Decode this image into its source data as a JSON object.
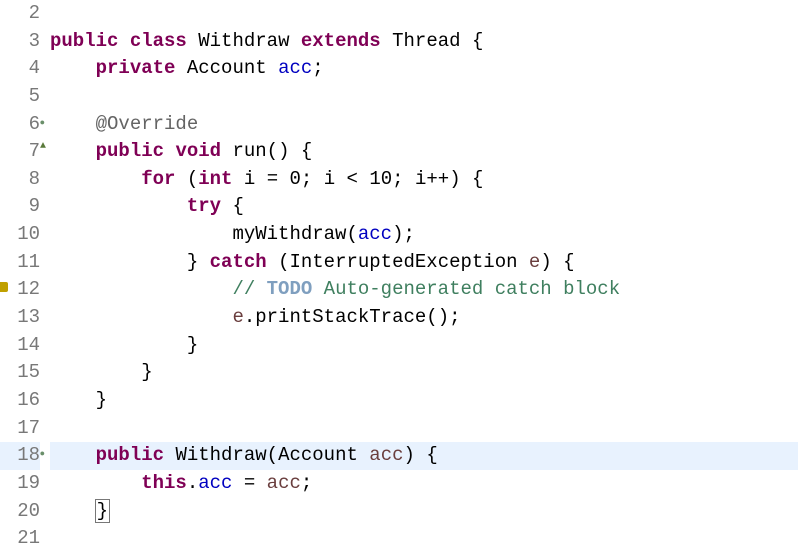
{
  "lines": {
    "2": {
      "num": "2"
    },
    "3": {
      "num": "3"
    },
    "4": {
      "num": "4"
    },
    "5": {
      "num": "5"
    },
    "6": {
      "num": "6"
    },
    "7": {
      "num": "7"
    },
    "8": {
      "num": "8"
    },
    "9": {
      "num": "9"
    },
    "10": {
      "num": "10"
    },
    "11": {
      "num": "11"
    },
    "12": {
      "num": "12"
    },
    "13": {
      "num": "13"
    },
    "14": {
      "num": "14"
    },
    "15": {
      "num": "15"
    },
    "16": {
      "num": "16"
    },
    "17": {
      "num": "17"
    },
    "18": {
      "num": "18"
    },
    "19": {
      "num": "19"
    },
    "20": {
      "num": "20"
    },
    "21": {
      "num": "21"
    }
  },
  "t": {
    "public": "public",
    "class": "class",
    "Withdraw": "Withdraw",
    "extends": "extends",
    "Thread": "Thread",
    "obrace": "{",
    "cbrace": "}",
    "private": "private",
    "Account": "Account",
    "acc_field": "acc",
    "semi": ";",
    "override": "@Override",
    "void": "void",
    "run": "run",
    "oparen": "(",
    "cparen": ")",
    "for": "for",
    "int": "int",
    "i": "i",
    "eq": "=",
    "zero": "0",
    "lt": "<",
    "ten": "10",
    "ipp": "i++",
    "try": "try",
    "myWithdraw": "myWithdraw",
    "acc_param": "acc",
    "catch": "catch",
    "IEx": "InterruptedException",
    "e": "e",
    "slashes": "// ",
    "TODO": "TODO",
    "todo_rest": " Auto-generated catch block",
    "printStack": "printStackTrace",
    "dot": ".",
    "this": "this",
    "sp1": " ",
    "sp4": "    ",
    "sp8": "        ",
    "sp12": "            ",
    "sp16": "                ",
    "sp20": "                    "
  }
}
